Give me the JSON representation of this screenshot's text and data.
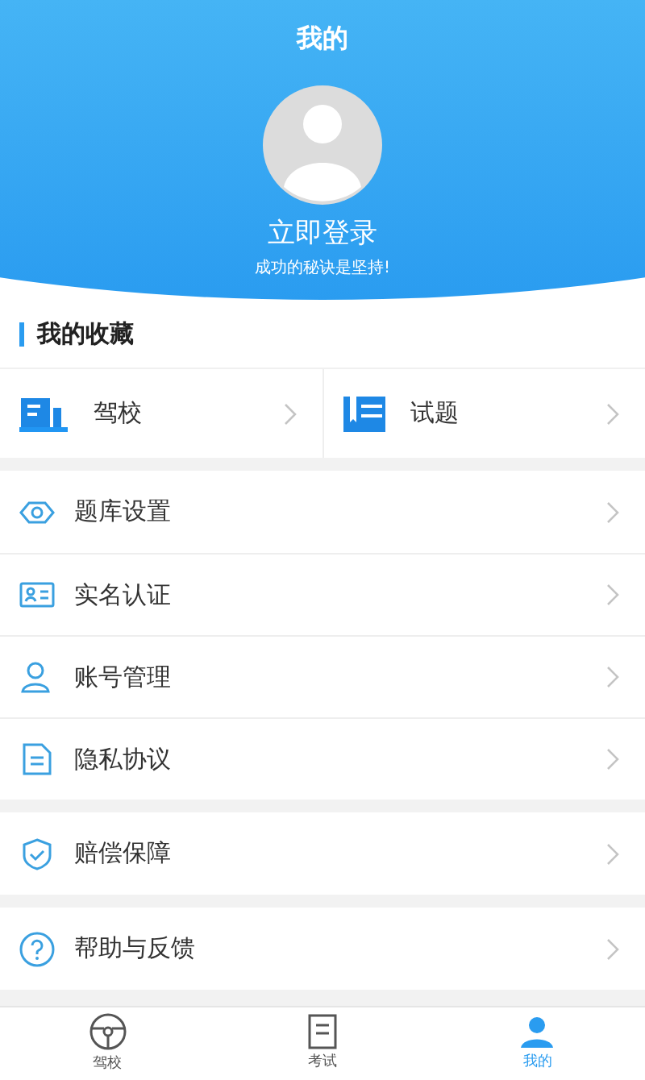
{
  "header": {
    "title": "我的",
    "login": "立即登录",
    "motto": "成功的秘诀是坚持!"
  },
  "favorites": {
    "title": "我的收藏",
    "items": [
      {
        "label": "驾校"
      },
      {
        "label": "试题"
      }
    ]
  },
  "menu_groups": [
    [
      {
        "label": "题库设置"
      },
      {
        "label": "实名认证"
      },
      {
        "label": "账号管理"
      },
      {
        "label": "隐私协议"
      }
    ],
    [
      {
        "label": "赔偿保障"
      }
    ],
    [
      {
        "label": "帮助与反馈"
      }
    ]
  ],
  "tab_bar": [
    {
      "label": "驾校",
      "selected": false
    },
    {
      "label": "考试",
      "selected": false
    },
    {
      "label": "我的",
      "selected": true
    }
  ]
}
